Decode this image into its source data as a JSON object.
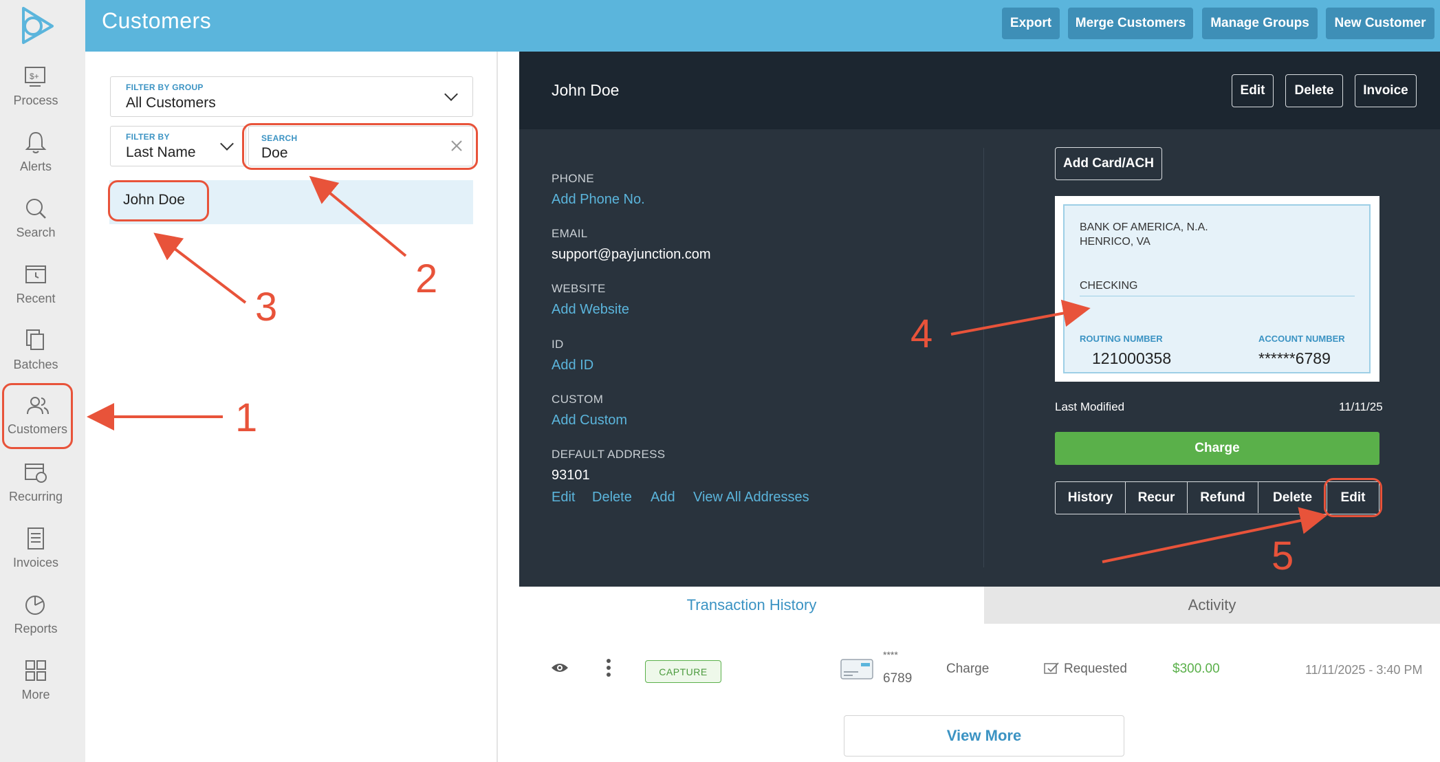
{
  "header": {
    "title": "Customers",
    "buttons": [
      "Export",
      "Merge Customers",
      "Manage Groups",
      "New Customer"
    ]
  },
  "nav": {
    "items": [
      {
        "label": "Process",
        "icon": "process-icon"
      },
      {
        "label": "Alerts",
        "icon": "bell-icon"
      },
      {
        "label": "Search",
        "icon": "search-icon"
      },
      {
        "label": "Recent",
        "icon": "recent-icon"
      },
      {
        "label": "Batches",
        "icon": "batches-icon"
      },
      {
        "label": "Customers",
        "icon": "customers-icon",
        "active": true
      },
      {
        "label": "Recurring",
        "icon": "recurring-icon"
      },
      {
        "label": "Invoices",
        "icon": "invoices-icon"
      },
      {
        "label": "Reports",
        "icon": "reports-icon"
      },
      {
        "label": "More",
        "icon": "grid-icon"
      }
    ]
  },
  "filters": {
    "group_label": "FILTER BY GROUP",
    "group_value": "All Customers",
    "by_label": "FILTER BY",
    "by_value": "Last Name",
    "search_label": "SEARCH",
    "search_value": "Doe"
  },
  "results": [
    "John Doe"
  ],
  "customer": {
    "name": "John Doe",
    "actions": [
      "Edit",
      "Delete",
      "Invoice"
    ],
    "fields": {
      "phone_label": "PHONE",
      "phone_value": "Add Phone No.",
      "email_label": "EMAIL",
      "email_value": "support@payjunction.com",
      "website_label": "WEBSITE",
      "website_value": "Add Website",
      "id_label": "ID",
      "id_value": "Add ID",
      "custom_label": "CUSTOM",
      "custom_value": "Add Custom",
      "address_label": "DEFAULT ADDRESS",
      "address_value": "93101"
    },
    "address_links": [
      "Edit",
      "Delete",
      "Add",
      "View All Addresses"
    ],
    "add_card": "Add Card/ACH",
    "check": {
      "bank": "BANK OF AMERICA, N.A.",
      "city": "HENRICO, VA",
      "type": "CHECKING",
      "routing_label": "ROUTING NUMBER",
      "routing_value": "121000358",
      "account_label": "ACCOUNT NUMBER",
      "account_value": "******6789"
    },
    "last_modified_label": "Last Modified",
    "last_modified_value": "11/11/25",
    "charge": "Charge",
    "card_actions": [
      "History",
      "Recur",
      "Refund",
      "Delete",
      "Edit"
    ]
  },
  "tabs": [
    "Transaction History",
    "Activity"
  ],
  "transaction": {
    "badge": "CAPTURE",
    "mask": "****",
    "last4": "6789",
    "type": "Charge",
    "status": "Requested",
    "amount": "$300.00",
    "date": "11/11/2025 - 3:40 PM"
  },
  "view_more": "View More",
  "annotations": [
    "1",
    "2",
    "3",
    "4",
    "5"
  ],
  "colors": {
    "header": "#5bb5dc",
    "accent": "#3b93c3",
    "dark": "#1c2630",
    "charge": "#5ab04a",
    "annotation": "#e8533a"
  }
}
